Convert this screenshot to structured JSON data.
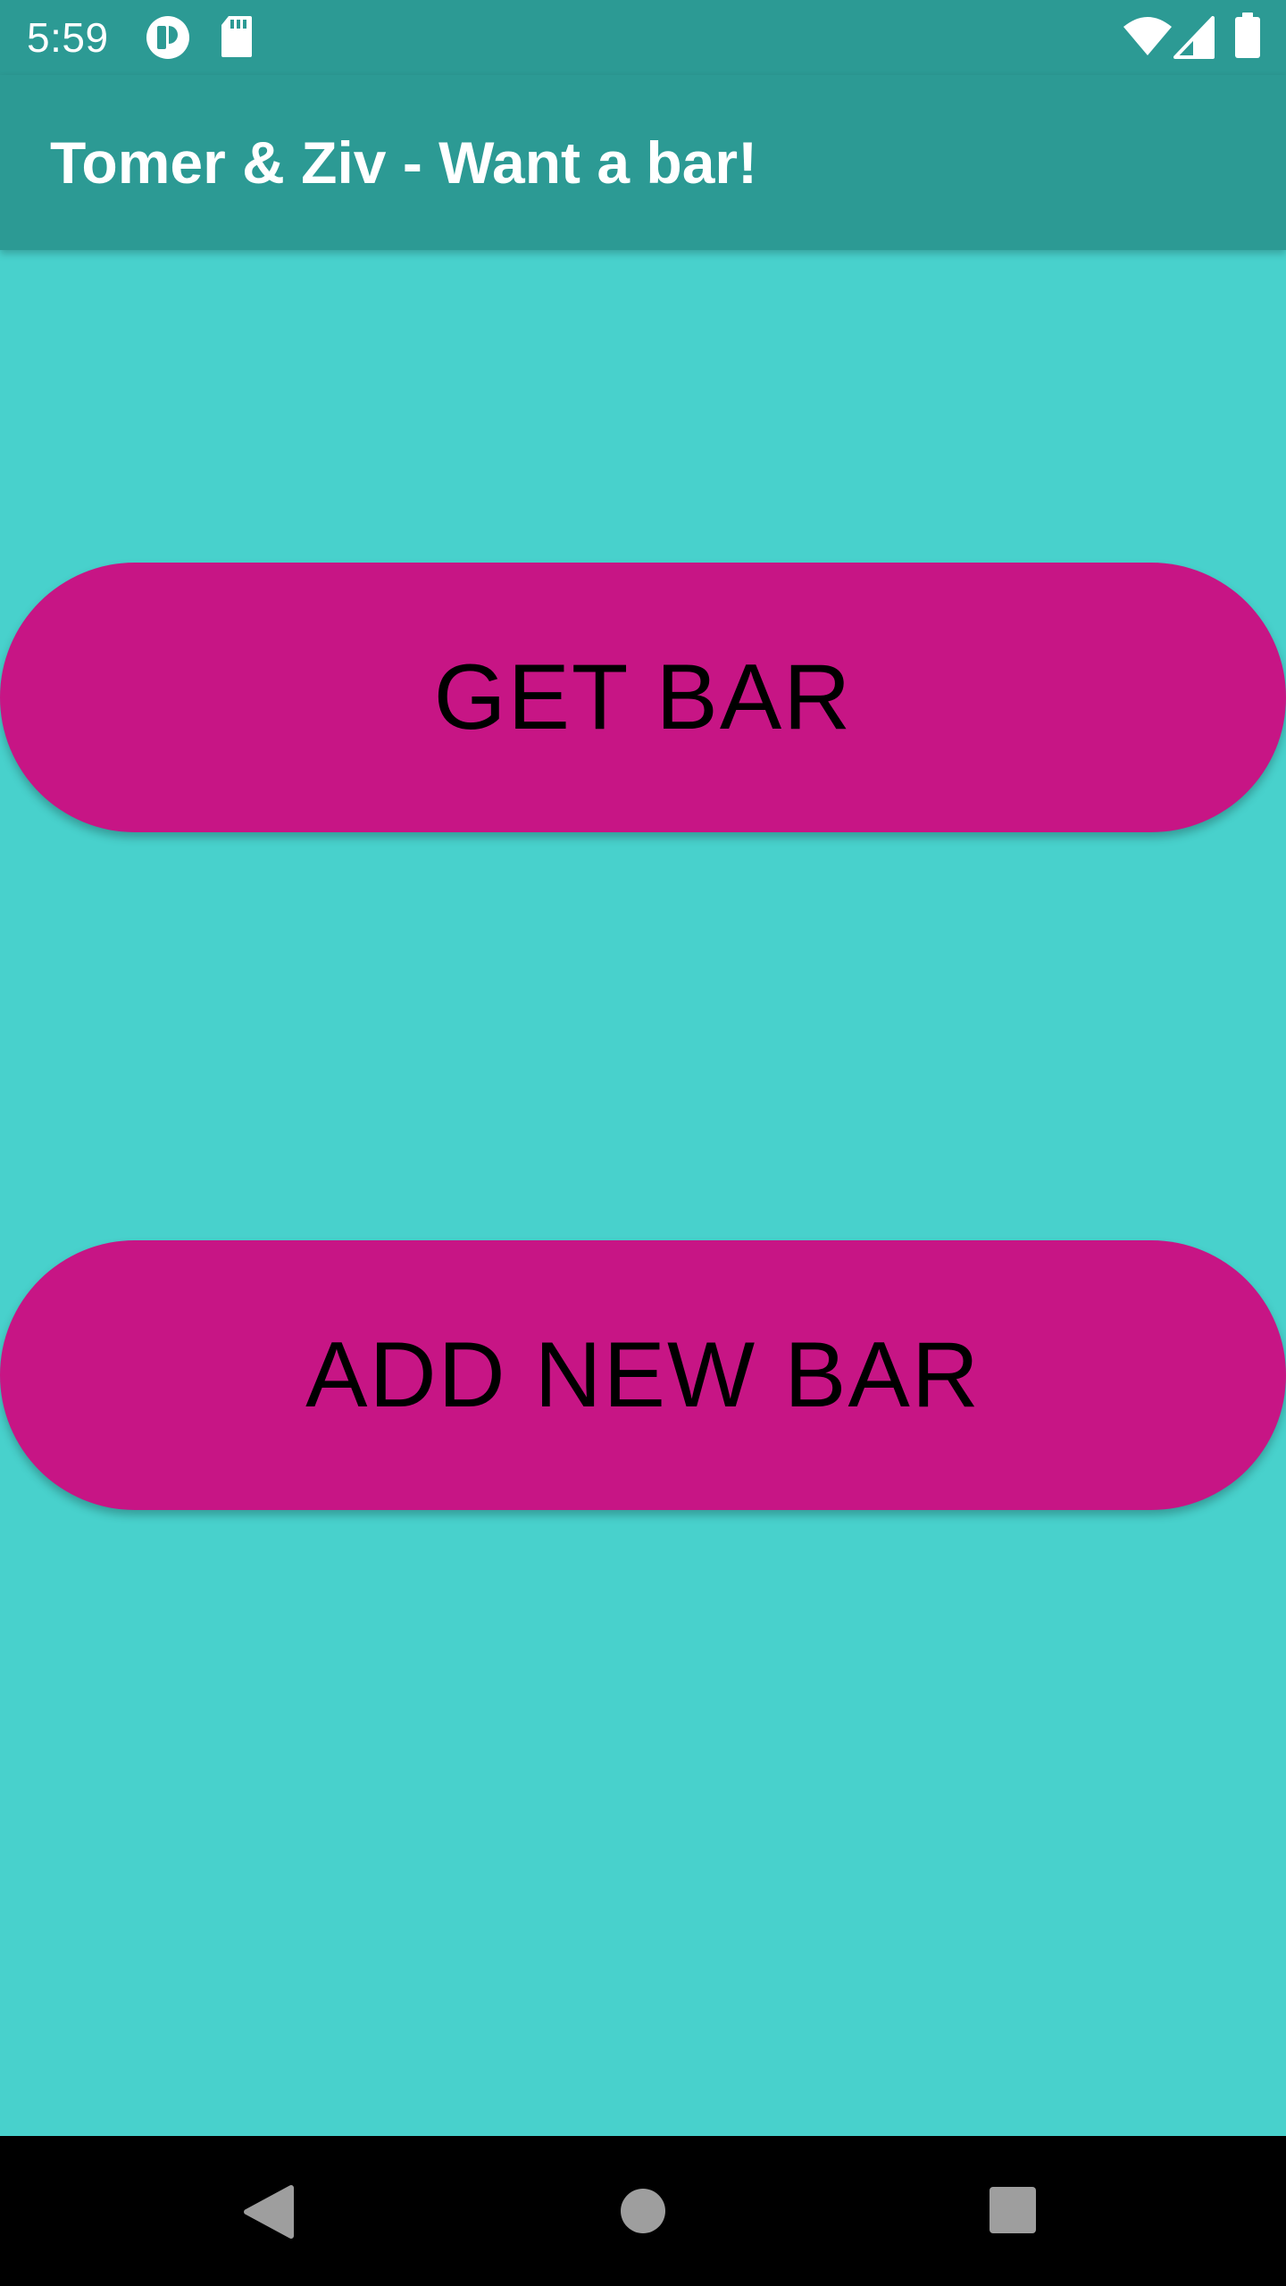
{
  "status_bar": {
    "time": "5:59",
    "left_icons": [
      "notification-app-icon",
      "sd-card-icon"
    ],
    "right_icons": [
      "wifi-icon",
      "cell-signal-icon",
      "battery-icon"
    ]
  },
  "app_bar": {
    "title": "Tomer & Ziv - Want a bar!"
  },
  "main": {
    "get_bar_label": "GET BAR",
    "add_new_bar_label": "ADD NEW BAR"
  },
  "nav_bar": {
    "buttons": [
      "back-icon",
      "home-icon",
      "recents-icon"
    ]
  },
  "colors": {
    "background": "#48D1CC",
    "app_bar": "#2C9A94",
    "button": "#C71585",
    "button_text": "#000000",
    "nav_bar": "#000000"
  }
}
